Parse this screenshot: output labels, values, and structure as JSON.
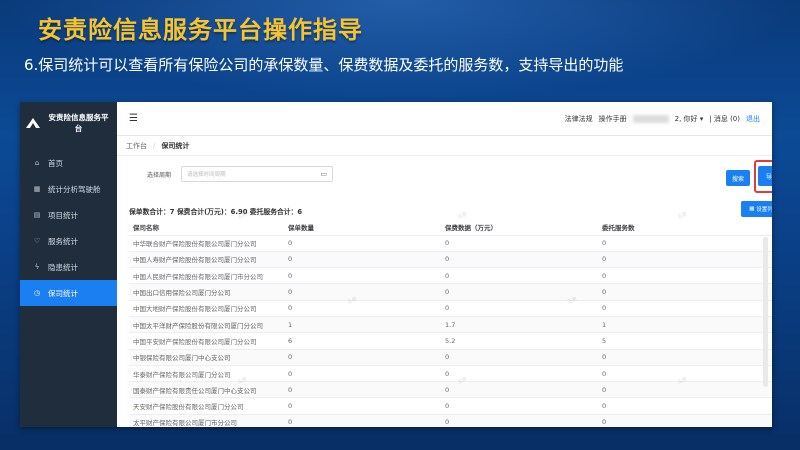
{
  "slide": {
    "title": "安责险信息服务平台操作指导",
    "subtitle": "6.保司统计可以查看所有保险公司的承保数量、保费数据及委托的服务数，支持导出的功能"
  },
  "app": {
    "brand": "安责险信息服务平台",
    "sidebar": [
      {
        "label": "首页",
        "icon": "home-icon",
        "glyph": "⌂"
      },
      {
        "label": "统计分析驾驶舱",
        "icon": "chart-icon",
        "glyph": "▦"
      },
      {
        "label": "项目统计",
        "icon": "document-icon",
        "glyph": "▤"
      },
      {
        "label": "服务统计",
        "icon": "heart-icon",
        "glyph": "♡"
      },
      {
        "label": "隐患统计",
        "icon": "bolt-icon",
        "glyph": "ϟ"
      },
      {
        "label": "保司统计",
        "icon": "clock-icon",
        "glyph": "◷"
      }
    ],
    "topbar": {
      "links": [
        "法律法规",
        "操作手册"
      ],
      "greeting": "2, 你好 ▾",
      "messages": "| 消息 (0)",
      "exit": "退出"
    },
    "breadcrumb": {
      "home": "工作台",
      "current": "保司统计"
    },
    "filter": {
      "label": "选择周期",
      "placeholder": "请选择时间周期"
    },
    "buttons": {
      "search": "搜索",
      "export": "导出",
      "columns": "设置列"
    },
    "summary": "保单数合计：7  保费合计(万元)：6.90  委托服务合计：6",
    "table": {
      "headers": [
        "保司名称",
        "保单数量",
        "保费数据（万元）",
        "委托服务数"
      ],
      "rows": [
        [
          "中华联合财产保险股份有限公司厦门分公司",
          "0",
          "0",
          "0"
        ],
        [
          "中国人寿财产保险股份有限公司厦门分公司",
          "0",
          "0",
          "0"
        ],
        [
          "中国人民财产保险股份有限公司厦门市分公司",
          "0",
          "0",
          "0"
        ],
        [
          "中国出口信用保险公司厦门分公司",
          "0",
          "0",
          "0"
        ],
        [
          "中国大地财产保险股份有限公司厦门分公司",
          "0",
          "0",
          "0"
        ],
        [
          "中国太平洋财产保险股份有限公司厦门分公司",
          "1",
          "1.7",
          "1"
        ],
        [
          "中国平安财产保险股份有限公司厦门分公司",
          "6",
          "5.2",
          "5"
        ],
        [
          "中银保险有限公司厦门中心支公司",
          "0",
          "0",
          "0"
        ],
        [
          "华泰财产保险有限公司厦门分公司",
          "0",
          "0",
          "0"
        ],
        [
          "国泰财产保险有限责任公司厦门中心支公司",
          "0",
          "0",
          "0"
        ],
        [
          "天安财产保险股份有限公司厦门分公司",
          "0",
          "0",
          "0"
        ],
        [
          "太平财产保险有限公司厦门市分公司",
          "0",
          "0",
          "0"
        ]
      ]
    },
    "watermark": "玉泉"
  }
}
